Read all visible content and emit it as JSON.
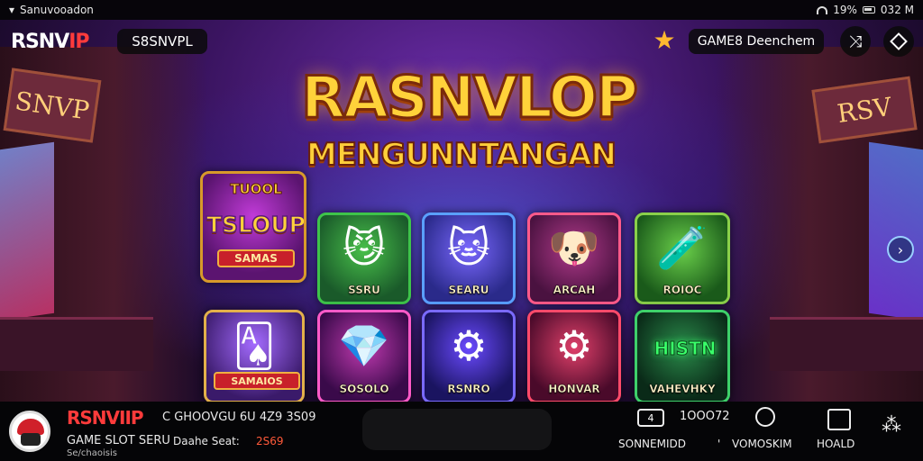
{
  "status_bar": {
    "left_text": "Sanuvooadon",
    "battery": "19%",
    "time": "032 M"
  },
  "top_bar": {
    "brand_white": "RSNV",
    "brand_red": "IP",
    "pill_text": "S8SNVPL",
    "game_pill": "GAME8 Deenchem"
  },
  "hero": {
    "title": "RASNVLOP",
    "subtitle": "MENGUNNTANGAN"
  },
  "tiles": {
    "slot": {
      "top": "TUOOL",
      "big": "TSLOUP",
      "ribbon": "SAMAS"
    },
    "cards": {
      "ribbon": "SAMAIOS"
    },
    "cat_green": {
      "label": "SSRU"
    },
    "cat_purple": {
      "label": "SEARU"
    },
    "dog": {
      "label": "ARCAH"
    },
    "potion": {
      "label": "ROIOC"
    },
    "gem": {
      "label": "SOSOLO"
    },
    "cannon_blue": {
      "label": "RSNRO"
    },
    "cannon_red": {
      "label": "HONVAR"
    },
    "neon": {
      "neon": "HISTN",
      "label": "VAHEVHKY"
    }
  },
  "bottom_bar": {
    "brand": "RSNVIIP",
    "info": "C GHOOVGU 6U 4Z9 3S09",
    "game": "GAME SLOT SERU",
    "label": "Daahe Seat:",
    "number": "2S69",
    "sub": "Se/chaoisis",
    "stat": "1OOO72",
    "ico1": "4",
    "t1": "SONNEMIDD",
    "t2_mark": "'",
    "t2": "VOMOSKIM",
    "t3": "HOALD"
  },
  "colors": {
    "accent_red": "#ff3b3b",
    "title_gold": "#ffd23a"
  },
  "icons": [
    "wifi-icon",
    "battery-icon",
    "star-icon",
    "share-icon",
    "diamond-icon",
    "next-arrow-icon",
    "avatar-icon",
    "timer-icon",
    "bag-icon",
    "network-icon"
  ]
}
